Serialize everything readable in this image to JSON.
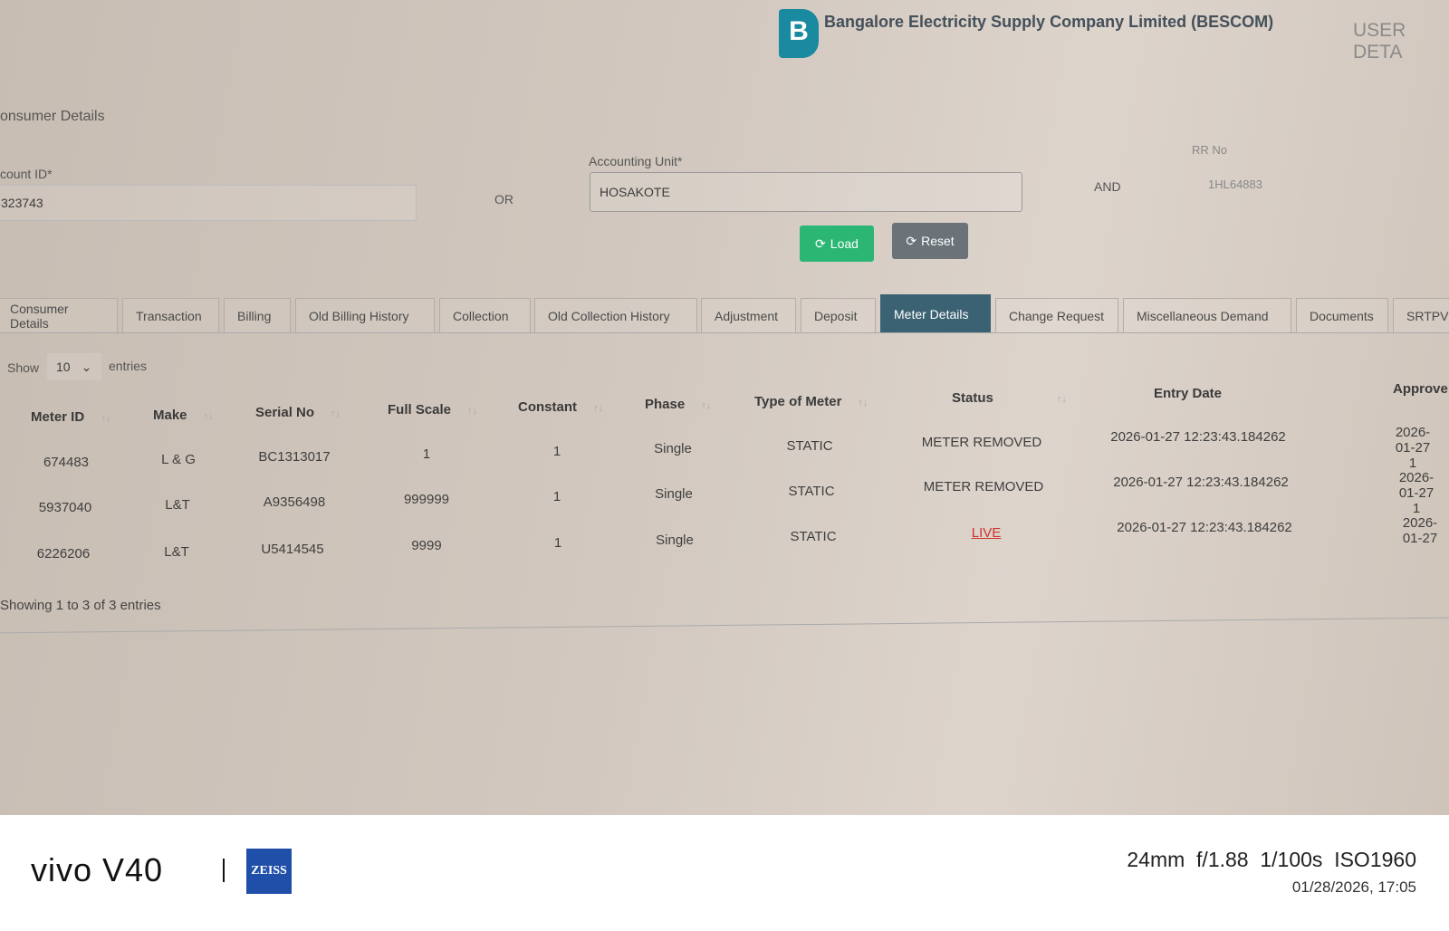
{
  "header": {
    "company": "Bangalore Electricity Supply Company Limited (BESCOM)",
    "logo_text": "B",
    "user_details": "USER DETA"
  },
  "section_title": "onsumer Details",
  "form": {
    "account_id_label": "count ID*",
    "account_id_value": "323743",
    "or": "OR",
    "accounting_unit_label": "Accounting Unit*",
    "accounting_unit_value": "HOSAKOTE",
    "and": "AND",
    "rr_no_label": "RR No",
    "rr_no_value": "1HL64883",
    "load_label": "Load",
    "reset_label": "Reset"
  },
  "colors": {
    "load": "#2bb673",
    "reset": "#6b7378",
    "active_tab": "#3b6272",
    "live_status": "#d0332e"
  },
  "tabs": [
    {
      "label": "Consumer Details"
    },
    {
      "label": "Transaction"
    },
    {
      "label": "Billing"
    },
    {
      "label": "Old Billing History"
    },
    {
      "label": "Collection"
    },
    {
      "label": "Old Collection History"
    },
    {
      "label": "Adjustment"
    },
    {
      "label": "Deposit"
    },
    {
      "label": "Meter Details",
      "active": true
    },
    {
      "label": "Change Request"
    },
    {
      "label": "Miscellaneous Demand"
    },
    {
      "label": "Documents"
    },
    {
      "label": "SRTPV"
    }
  ],
  "table": {
    "show": "Show",
    "entries_value": "10",
    "entries": "entries",
    "headers": [
      "Meter ID",
      "Make",
      "Serial No",
      "Full Scale",
      "Constant",
      "Phase",
      "Type of Meter",
      "Status",
      "Entry Date",
      "Approve"
    ],
    "rows": [
      [
        "674483",
        "L & G",
        "BC1313017",
        "1",
        "1",
        "Single",
        "STATIC",
        "METER REMOVED",
        "2026-01-27 12:23:43.184262",
        "2026-01-27 1"
      ],
      [
        "5937040",
        "L&T",
        "A9356498",
        "999999",
        "1",
        "Single",
        "STATIC",
        "METER REMOVED",
        "2026-01-27 12:23:43.184262",
        "2026-01-27 1"
      ],
      [
        "6226206",
        "L&T",
        "U5414545",
        "9999",
        "1",
        "Single",
        "STATIC",
        "LIVE",
        "2026-01-27 12:23:43.184262",
        "2026-01-27"
      ]
    ],
    "info": "Showing 1 to 3 of 3 entries"
  },
  "watermark": {
    "brand": "vivo V40",
    "lens": "ZEISS",
    "specs": "24mm  f/1.88  1/100s  ISO1960",
    "datetime": "01/28/2026, 17:05"
  }
}
